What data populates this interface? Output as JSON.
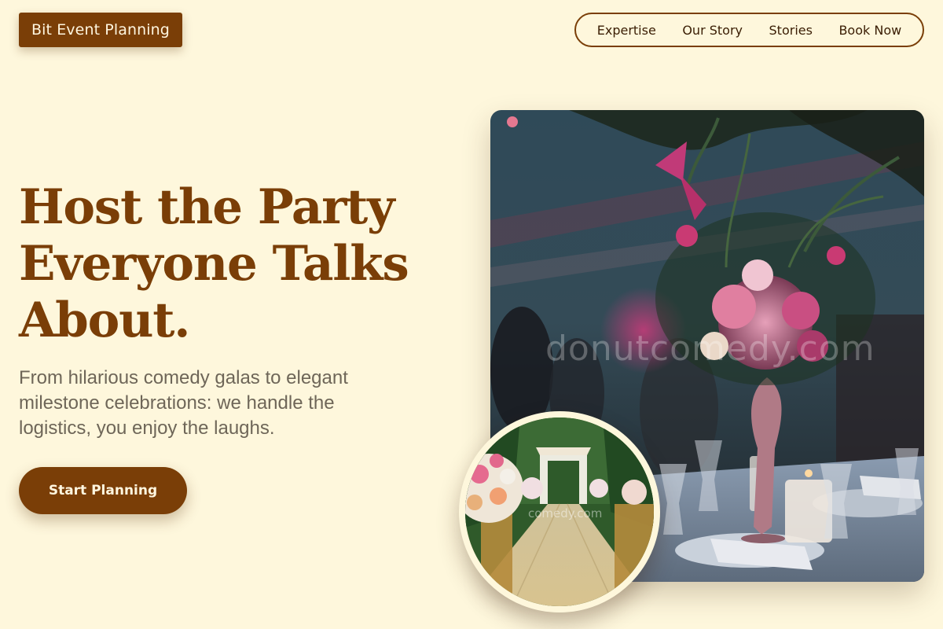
{
  "brand": {
    "name": "Bit Event Planning"
  },
  "nav": {
    "items": [
      {
        "label": "Expertise"
      },
      {
        "label": "Our Story"
      },
      {
        "label": "Stories"
      },
      {
        "label": "Book Now"
      }
    ]
  },
  "hero": {
    "headline": "Host the Party Everyone Talks About.",
    "subheadline": "From hilarious comedy galas to elegant milestone celebrations: we handle the logistics, you enjoy the laughs.",
    "cta_label": "Start Planning"
  },
  "images": {
    "main_watermark": "donutcomedy.com",
    "inset_watermark": "comedy.com"
  },
  "colors": {
    "background": "#fef7dc",
    "accent": "#7a3e07",
    "text_muted": "#6e6658"
  }
}
